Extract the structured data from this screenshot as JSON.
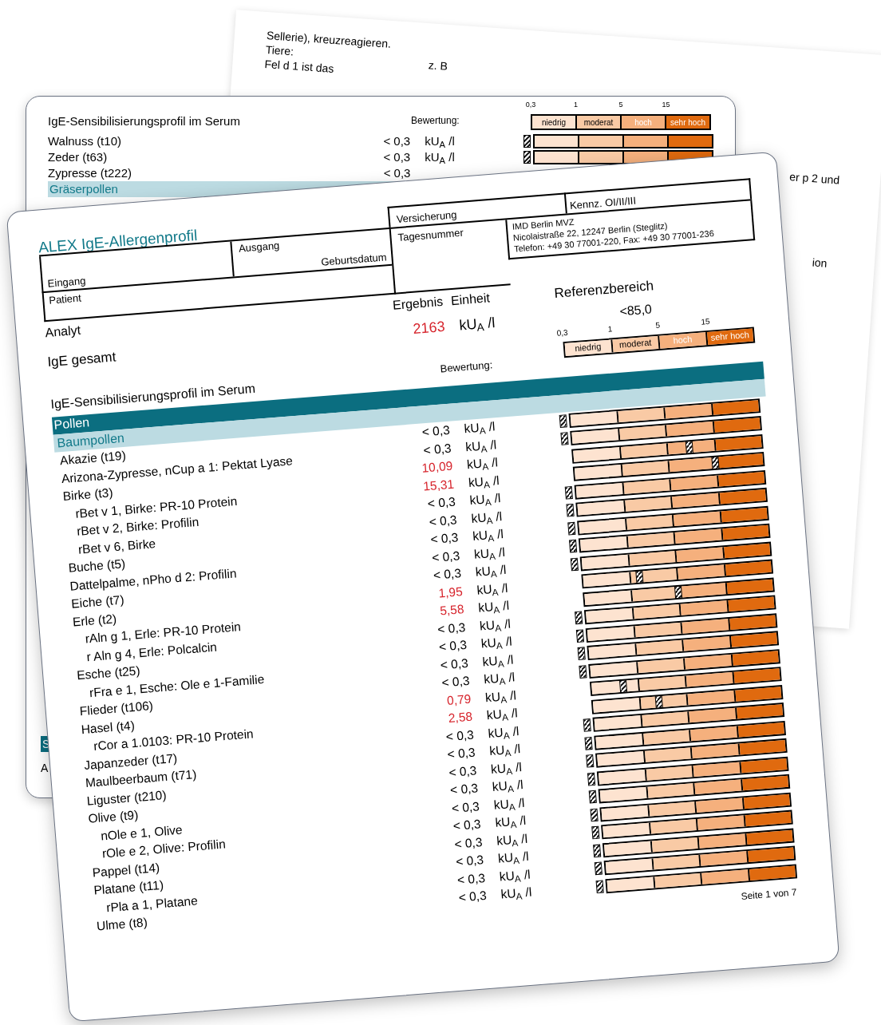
{
  "background_sheet": {
    "lines": [
      "Sellerie), kreuzreagieren.",
      "Tiere:",
      "Fel d 1 ist das"
    ],
    "fragment_left": "z. B",
    "fragment_right": "er p 2 und",
    "fragment_lower": "ion"
  },
  "back_page": {
    "section_title": "IgE-Sensibilisierungsprofil im Serum",
    "rating_label": "Bewertung:",
    "scale": {
      "ticks": [
        "0,3",
        "1",
        "5",
        "15"
      ],
      "levels": [
        "niedrig",
        "moderat",
        "hoch",
        "sehr hoch"
      ]
    },
    "rows": [
      {
        "name": "Walnuss (t10)",
        "value": "< 0,3",
        "unit": "kU$_{A}$ /l",
        "level": 0
      },
      {
        "name": "Zeder (t63)",
        "value": "< 0,3",
        "unit": "kU$_{A}$ /l",
        "level": 0
      },
      {
        "name": "Zypresse (t222)",
        "value": "< 0,3"
      }
    ],
    "group": "Gräserpollen",
    "bottom_band": "S",
    "bottom_text": "A"
  },
  "front_page": {
    "title": "ALEX IgE-Allergenprofil",
    "form": {
      "insurance": "Versicherung",
      "code": "Kennz. OI/II/III",
      "entry": "Eingang",
      "exit": "Ausgang",
      "birth_date": "Geburtsdatum",
      "day_number": "Tagesnummer",
      "lab_address": [
        "IMD Berlin MVZ",
        "Nicolaistraße 22, 12247 Berlin (Steglitz)",
        "Telefon: +49 30 77001-220, Fax: +49 30 77001-236"
      ],
      "patient": "Patient"
    },
    "result_header": {
      "analyte": "Analyt",
      "result": "Ergebnis",
      "unit": "Einheit",
      "reference": "Referenzbereich"
    },
    "total": {
      "name": "IgE gesamt",
      "value": "2163",
      "flagged": true,
      "unit": "kU$_{A}$ /l",
      "reference": "<85,0"
    },
    "rating_label": "Bewertung:",
    "scale": {
      "ticks": [
        "0,3",
        "1",
        "5",
        "15"
      ],
      "levels": [
        "niedrig",
        "moderat",
        "hoch",
        "sehr hoch"
      ]
    },
    "section_title": "IgE-Sensibilisierungsprofil im Serum",
    "category": "Pollen",
    "group": "Baumpollen",
    "rows": [
      {
        "name": "Akazie (t19)",
        "value": "< 0,3",
        "unit": "kU$_{A}$ /l",
        "flagged": false,
        "level": 0
      },
      {
        "name": "Arizona-Zypresse, nCup a 1: Pektat Lyase",
        "value": "< 0,3",
        "unit": "kU$_{A}$ /l",
        "flagged": false,
        "level": 0
      },
      {
        "name": "Birke (t3)",
        "value": "10,09",
        "unit": "kU$_{A}$ /l",
        "flagged": true,
        "level": 0.62,
        "children": [
          {
            "name": "rBet v 1, Birke: PR-10 Protein",
            "value": "15,31",
            "unit": "kU$_{A}$ /l",
            "flagged": true,
            "level": 0.75
          },
          {
            "name": "rBet v 2, Birke: Profilin",
            "value": "< 0,3",
            "unit": "kU$_{A}$ /l",
            "flagged": false,
            "level": 0
          },
          {
            "name": "rBet v 6, Birke",
            "value": "< 0,3",
            "unit": "kU$_{A}$ /l",
            "flagged": false,
            "level": 0
          }
        ]
      },
      {
        "name": "Buche (t5)",
        "value": "< 0,3",
        "unit": "kU$_{A}$ /l",
        "flagged": false,
        "level": 0
      },
      {
        "name": "Dattelpalme, nPho d 2: Profilin",
        "value": "< 0,3",
        "unit": "kU$_{A}$ /l",
        "flagged": false,
        "level": 0
      },
      {
        "name": "Eiche (t7)",
        "value": "< 0,3",
        "unit": "kU$_{A}$ /l",
        "flagged": false,
        "level": 0
      },
      {
        "name": "Erle (t2)",
        "value": "1,95",
        "unit": "kU$_{A}$ /l",
        "flagged": true,
        "level": 0.3,
        "children": [
          {
            "name": "rAln g 1, Erle: PR-10 Protein",
            "value": "5,58",
            "unit": "kU$_{A}$ /l",
            "flagged": true,
            "level": 0.5
          },
          {
            "name": "r Aln g 4, Erle: Polcalcin",
            "value": "< 0,3",
            "unit": "kU$_{A}$ /l",
            "flagged": false,
            "level": 0
          }
        ]
      },
      {
        "name": "Esche (t25)",
        "value": "< 0,3",
        "unit": "kU$_{A}$ /l",
        "flagged": false,
        "level": 0,
        "children": [
          {
            "name": "rFra e 1, Esche: Ole e 1-Familie",
            "value": "< 0,3",
            "unit": "kU$_{A}$ /l",
            "flagged": false,
            "level": 0
          }
        ]
      },
      {
        "name": "Flieder (t106)",
        "value": "< 0,3",
        "unit": "kU$_{A}$ /l",
        "flagged": false,
        "level": 0
      },
      {
        "name": "Hasel (t4)",
        "value": "0,79",
        "unit": "kU$_{A}$ /l",
        "flagged": true,
        "level": 0.17,
        "children": [
          {
            "name": "rCor a 1.0103: PR-10 Protein",
            "value": "2,58",
            "unit": "kU$_{A}$ /l",
            "flagged": true,
            "level": 0.35
          }
        ]
      },
      {
        "name": "Japanzeder (t17)",
        "value": "< 0,3",
        "unit": "kU$_{A}$ /l",
        "flagged": false,
        "level": 0
      },
      {
        "name": "Maulbeerbaum (t71)",
        "value": "< 0,3",
        "unit": "kU$_{A}$ /l",
        "flagged": false,
        "level": 0
      },
      {
        "name": "Liguster (t210)",
        "value": "< 0,3",
        "unit": "kU$_{A}$ /l",
        "flagged": false,
        "level": 0
      },
      {
        "name": "Olive (t9)",
        "value": "< 0,3",
        "unit": "kU$_{A}$ /l",
        "flagged": false,
        "level": 0,
        "children": [
          {
            "name": "nOle e 1, Olive",
            "value": "< 0,3",
            "unit": "kU$_{A}$ /l",
            "flagged": false,
            "level": 0
          },
          {
            "name": "rOle e 2, Olive: Profilin",
            "value": "< 0,3",
            "unit": "kU$_{A}$ /l",
            "flagged": false,
            "level": 0
          }
        ]
      },
      {
        "name": "Pappel (t14)",
        "value": "< 0,3",
        "unit": "kU$_{A}$ /l",
        "flagged": false,
        "level": 0
      },
      {
        "name": "Platane (t11)",
        "value": "< 0,3",
        "unit": "kU$_{A}$ /l",
        "flagged": false,
        "level": 0,
        "children": [
          {
            "name": "rPla a 1, Platane",
            "value": "< 0,3",
            "unit": "kU$_{A}$ /l",
            "flagged": false,
            "level": 0
          }
        ]
      },
      {
        "name": "Ulme (t8)",
        "value": "< 0,3",
        "unit": "kU$_{A}$ /l",
        "flagged": false,
        "level": 0
      }
    ],
    "page_number": "Seite 1 von 7"
  }
}
